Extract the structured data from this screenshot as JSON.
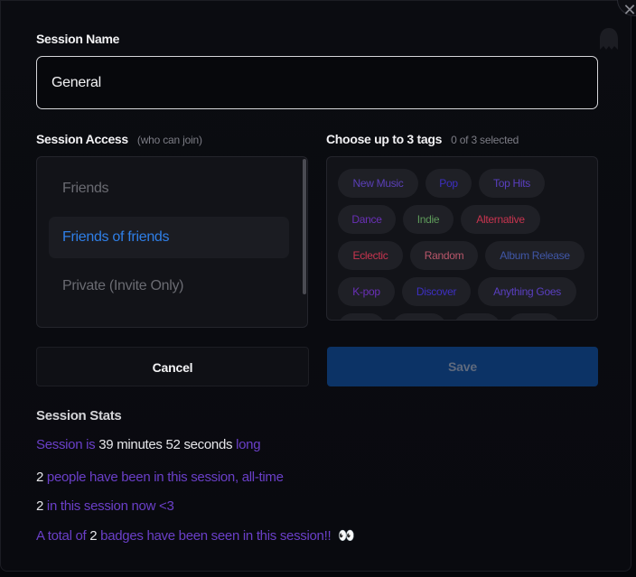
{
  "close_button": {
    "icon": "close-icon",
    "glyph": "✕"
  },
  "decor": {
    "icon": "ghost-icon"
  },
  "session_name": {
    "label": "Session Name",
    "value": "General"
  },
  "session_access": {
    "label": "Session Access",
    "hint": "(who can join)",
    "options": [
      {
        "label": "Friends",
        "selected": false
      },
      {
        "label": "Friends of friends",
        "selected": true
      },
      {
        "label": "Private (Invite Only)",
        "selected": false
      }
    ],
    "selected_color": "#2f7fe8"
  },
  "tags": {
    "label": "Choose up to 3 tags",
    "counter": "0 of 3 selected",
    "items": [
      {
        "label": "New Music",
        "color": "#5b3fb8"
      },
      {
        "label": "Pop",
        "color": "#3d2fc2"
      },
      {
        "label": "Top Hits",
        "color": "#5a3fc0"
      },
      {
        "label": "Dance",
        "color": "#6a30b8"
      },
      {
        "label": "Indie",
        "color": "#5e9a5a"
      },
      {
        "label": "Alternative",
        "color": "#c8344f"
      },
      {
        "label": "Eclectic",
        "color": "#c8344f"
      },
      {
        "label": "Random",
        "color": "#b8566a"
      },
      {
        "label": "Album Release",
        "color": "#4057a8"
      },
      {
        "label": "K-pop",
        "color": "#6a30b8"
      },
      {
        "label": "Discover",
        "color": "#3d2fc2"
      },
      {
        "label": "Anything Goes",
        "color": "#5a3fc0"
      }
    ]
  },
  "buttons": {
    "cancel": "Cancel",
    "save": "Save"
  },
  "stats": {
    "title": "Session Stats",
    "duration": {
      "prefix": "Session is",
      "value": "39 minutes 52 seconds",
      "suffix": "long"
    },
    "all_time": {
      "value": "2",
      "text": "people have been in this session, all-time"
    },
    "now": {
      "value": "2",
      "text": "in this session now <3"
    },
    "badges": {
      "prefix": "A total of",
      "value": "2",
      "text": "badges have been seen in this session!!",
      "emoji": "👀"
    }
  }
}
